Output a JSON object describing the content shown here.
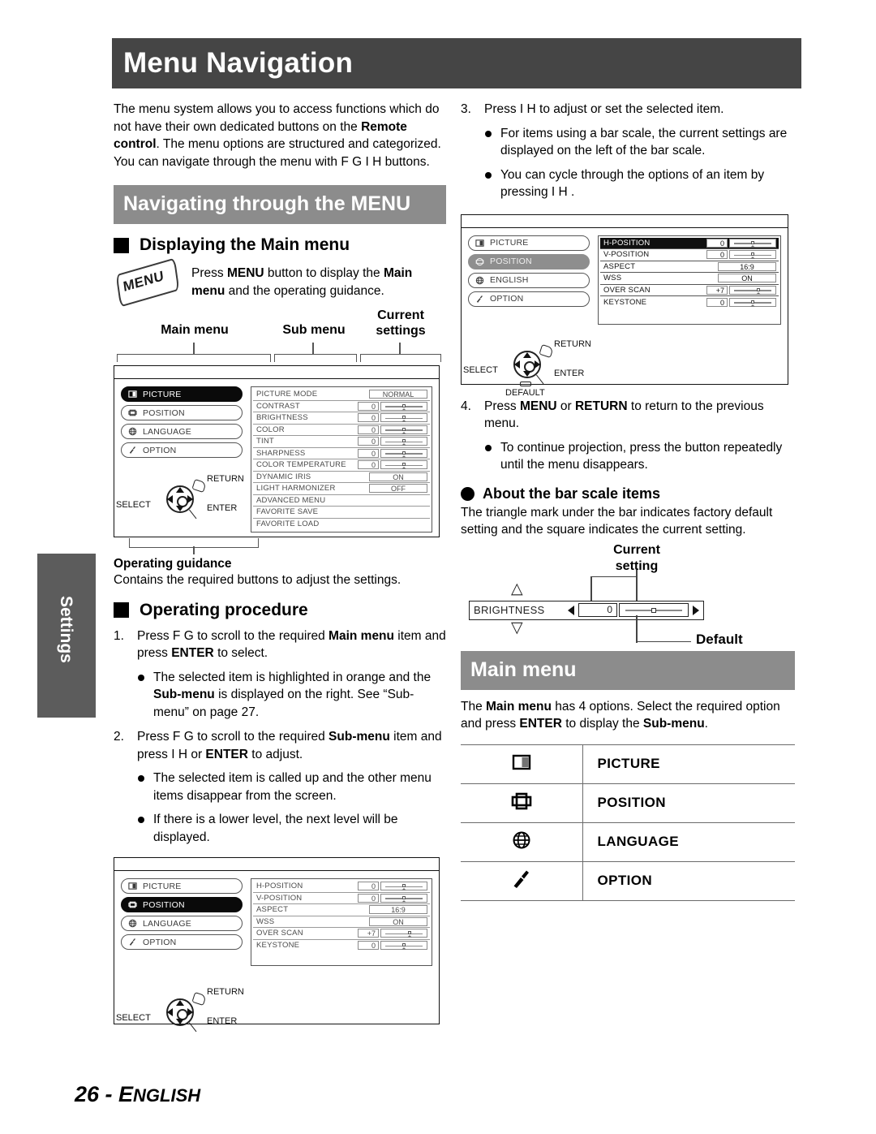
{
  "page": {
    "title": "Menu Navigation",
    "side_tab": "Settings",
    "footer_number": "26 - ",
    "footer_lang_cap": "E",
    "footer_lang_rest": "NGLISH"
  },
  "left": {
    "intro_1": "The menu system allows you to access functions which do not have their own dedicated buttons on the ",
    "intro_b1": "Remote control",
    "intro_2": ". The menu options are structured and categorized. You can navigate through the menu with F G I H  buttons.",
    "section_header": "Navigating through the MENU",
    "displaying_head": "Displaying the Main menu",
    "menu_key_label": "MENU",
    "press_menu_1": "Press ",
    "press_menu_b1": "MENU",
    "press_menu_2": " button to display the ",
    "press_menu_b2": "Main menu",
    "press_menu_3": " and the operating guidance.",
    "callout_main": "Main menu",
    "callout_sub": "Sub menu",
    "callout_current": "Current settings",
    "operating_guidance_head": "Operating guidance",
    "operating_guidance_text": "Contains the required buttons to adjust the settings.",
    "operating_procedure_head": "Operating procedure",
    "step1_num": "1.",
    "step1_a": "Press F  G  to scroll to the required ",
    "step1_b": "Main menu",
    "step1_c": " item and press ",
    "step1_d": "ENTER",
    "step1_e": " to select.",
    "step1_bullet1_a": "The selected item is highlighted in orange and the ",
    "step1_bullet1_b": "Sub-menu",
    "step1_bullet1_c": " is displayed on the right. See “Sub-menu” on page 27.",
    "step2_num": "2.",
    "step2_a": "Press F  G  to scroll to the required ",
    "step2_b": "Sub-menu",
    "step2_c": " item and press I  H  or ",
    "step2_d": "ENTER",
    "step2_e": " to adjust.",
    "step2_bullet1": "The selected item is called up and the other menu items disappear from the screen.",
    "step2_bullet2": "If there is a lower level, the next level will be displayed."
  },
  "right": {
    "step3_num": "3.",
    "step3_text": "Press I H   to adjust or set the selected item.",
    "step3_bullet1": "For items using a bar scale, the current settings are displayed on the left of the bar scale.",
    "step3_bullet2": "You can cycle through the options of an item by pressing I H .",
    "step4_num": "4.",
    "step4_a": "Press ",
    "step4_b": "MENU",
    "step4_c": " or ",
    "step4_d": "RETURN",
    "step4_e": " to return to the previous menu.",
    "step4_bullet1": "To continue projection, press the button repeatedly until the menu disappears.",
    "bar_scale_head": "About the bar scale items",
    "bar_scale_text": "The triangle mark under the bar indicates factory default setting and the square indicates the current setting.",
    "main_menu_header": "Main menu",
    "main_menu_intro_a": "The ",
    "main_menu_intro_b": "Main menu",
    "main_menu_intro_c": " has 4 options. Select the required option and press ",
    "main_menu_intro_d": "ENTER",
    "main_menu_intro_e": " to display the ",
    "main_menu_intro_f": "Sub-menu",
    "main_menu_intro_g": "."
  },
  "bar_figure": {
    "current_setting_label": "Current setting",
    "item_name": "BRIGHTNESS",
    "value": "0",
    "default_label": "Default"
  },
  "osd_picture": {
    "main_items": [
      {
        "label": "PICTURE",
        "icon": "picture-icon",
        "state": "selected-black"
      },
      {
        "label": "POSITION",
        "icon": "position-icon",
        "state": "normal"
      },
      {
        "label": "LANGUAGE",
        "icon": "globe-icon",
        "state": "normal"
      },
      {
        "label": "OPTION",
        "icon": "wrench-icon",
        "state": "normal"
      }
    ],
    "sub_items": [
      {
        "name": "PICTURE MODE",
        "type": "value",
        "value": "NORMAL"
      },
      {
        "name": "CONTRAST",
        "type": "scale",
        "value": "0"
      },
      {
        "name": "BRIGHTNESS",
        "type": "scale",
        "value": "0"
      },
      {
        "name": "COLOR",
        "type": "scale",
        "value": "0"
      },
      {
        "name": "TINT",
        "type": "scale",
        "value": "0"
      },
      {
        "name": "SHARPNESS",
        "type": "scale",
        "value": "0"
      },
      {
        "name": "COLOR TEMPERATURE",
        "type": "scale",
        "value": "0"
      },
      {
        "name": "DYNAMIC IRIS",
        "type": "value",
        "value": "ON"
      },
      {
        "name": "LIGHT HARMONIZER",
        "type": "value",
        "value": "OFF"
      },
      {
        "name": "ADVANCED MENU",
        "type": "none",
        "value": ""
      },
      {
        "name": "FAVORITE SAVE",
        "type": "none",
        "value": ""
      },
      {
        "name": "FAVORITE LOAD",
        "type": "none",
        "value": ""
      }
    ],
    "pad": {
      "select": "SELECT",
      "return": "RETURN",
      "enter": "ENTER"
    }
  },
  "osd_position_left": {
    "main_items": [
      {
        "label": "PICTURE",
        "icon": "picture-icon",
        "state": "normal"
      },
      {
        "label": "POSITION",
        "icon": "position-icon",
        "state": "selected-black"
      },
      {
        "label": "LANGUAGE",
        "icon": "globe-icon",
        "state": "normal"
      },
      {
        "label": "OPTION",
        "icon": "wrench-icon",
        "state": "normal"
      }
    ],
    "sub_items": [
      {
        "name": "H-POSITION",
        "type": "scale",
        "value": "0"
      },
      {
        "name": "V-POSITION",
        "type": "scale",
        "value": "0"
      },
      {
        "name": "ASPECT",
        "type": "value",
        "value": "16:9"
      },
      {
        "name": "WSS",
        "type": "value",
        "value": "ON"
      },
      {
        "name": "OVER SCAN",
        "type": "scale",
        "value": "+7"
      },
      {
        "name": "KEYSTONE",
        "type": "scale",
        "value": "0"
      }
    ],
    "pad": {
      "select": "SELECT",
      "return": "RETURN",
      "enter": "ENTER"
    }
  },
  "osd_position_right": {
    "main_items": [
      {
        "label": "PICTURE",
        "icon": "picture-icon",
        "state": "normal"
      },
      {
        "label": "POSITION",
        "icon": "position-icon",
        "state": "selected-gray"
      },
      {
        "label": "ENGLISH",
        "icon": "globe-icon",
        "state": "normal"
      },
      {
        "label": "OPTION",
        "icon": "wrench-icon",
        "state": "normal"
      }
    ],
    "sub_items": [
      {
        "name": "H-POSITION",
        "type": "scale",
        "value": "0",
        "highlight": true
      },
      {
        "name": "V-POSITION",
        "type": "scale",
        "value": "0"
      },
      {
        "name": "ASPECT",
        "type": "value",
        "value": "16:9"
      },
      {
        "name": "WSS",
        "type": "value",
        "value": "ON"
      },
      {
        "name": "OVER SCAN",
        "type": "scale",
        "value": "+7"
      },
      {
        "name": "KEYSTONE",
        "type": "scale",
        "value": "0"
      }
    ],
    "pad": {
      "select": "SELECT",
      "return": "RETURN",
      "enter": "ENTER",
      "default": "DEFAULT"
    }
  },
  "main_menu_table": [
    {
      "icon": "picture-icon",
      "label": "PICTURE"
    },
    {
      "icon": "position-icon",
      "label": "POSITION"
    },
    {
      "icon": "globe-icon",
      "label": "LANGUAGE"
    },
    {
      "icon": "wrench-icon",
      "label": "OPTION"
    }
  ],
  "colors": {
    "title_bar": "#454545",
    "section_header": "#8c8c8c",
    "side_tab": "#5c5c5c"
  }
}
